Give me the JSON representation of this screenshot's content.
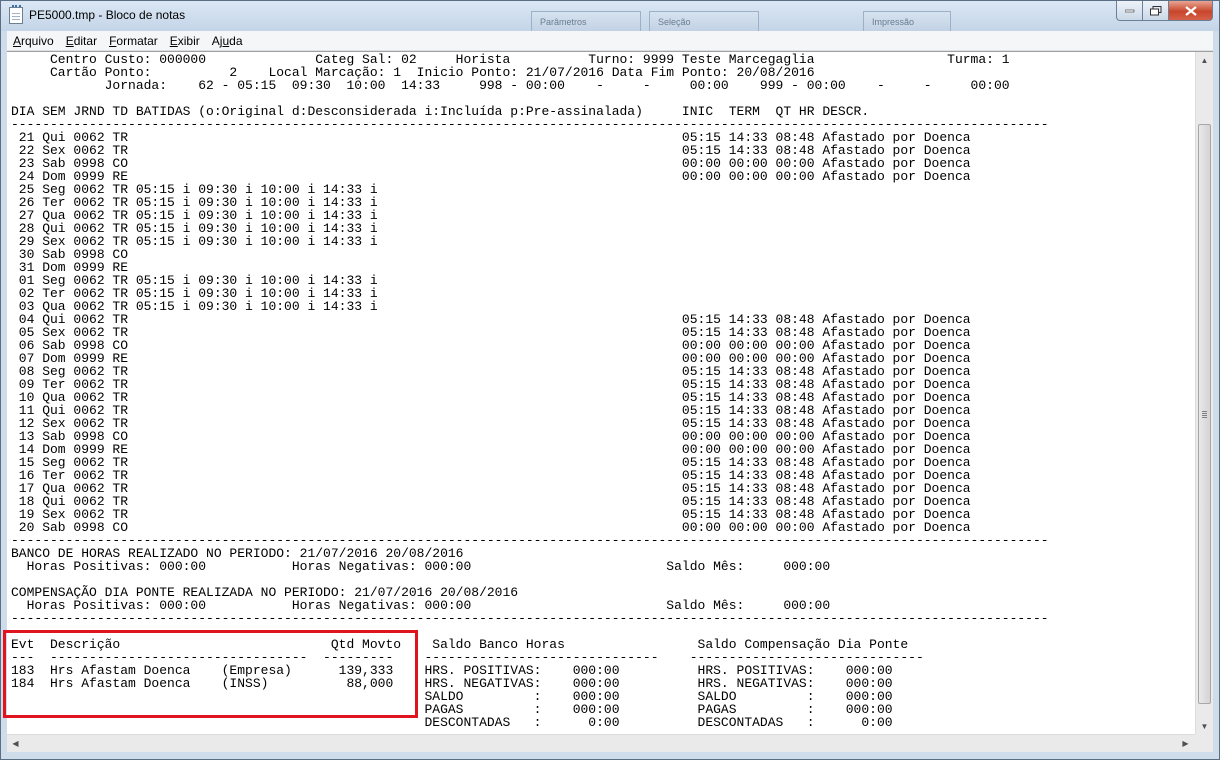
{
  "window": {
    "title": "PE5000.tmp - Bloco de notas",
    "background_tabs": [
      "Parâmetros",
      "Seleção",
      "Impressão"
    ]
  },
  "menu": [
    {
      "prefix": "",
      "underline": "A",
      "rest": "rquivo"
    },
    {
      "prefix": "",
      "underline": "E",
      "rest": "ditar"
    },
    {
      "prefix": "",
      "underline": "F",
      "rest": "ormatar"
    },
    {
      "prefix": "",
      "underline": "E",
      "rest": "xibir"
    },
    {
      "prefix": "Aj",
      "underline": "u",
      "rest": "da"
    }
  ],
  "document": {
    "lines": [
      "     Centro Custo: 000000              Categ Sal: 02     Horista          Turno: 9999 Teste Marcegaglia                 Turma: 1",
      "     Cartão Ponto:          2    Local Marcação: 1  Inicio Ponto: 21/07/2016 Data Fim Ponto: 20/08/2016",
      "            Jornada:    62 - 05:15  09:30  10:00  14:33     998 - 00:00    -     -     00:00    999 - 00:00    -     -     00:00",
      "",
      "DIA SEM JRND TD BATIDAS (o:Original d:Desconsiderada i:Incluída p:Pre-assinalada)     INIC  TERM  QT HR DESCR.",
      "-------------------------------------------------------------------------------------------------------------------------------------",
      " 21 Qui 0062 TR                                                                       05:15 14:33 08:48 Afastado por Doenca",
      " 22 Sex 0062 TR                                                                       05:15 14:33 08:48 Afastado por Doenca",
      " 23 Sab 0998 CO                                                                       00:00 00:00 00:00 Afastado por Doenca",
      " 24 Dom 0999 RE                                                                       00:00 00:00 00:00 Afastado por Doenca",
      " 25 Seg 0062 TR 05:15 i 09:30 i 10:00 i 14:33 i",
      " 26 Ter 0062 TR 05:15 i 09:30 i 10:00 i 14:33 i",
      " 27 Qua 0062 TR 05:15 i 09:30 i 10:00 i 14:33 i",
      " 28 Qui 0062 TR 05:15 i 09:30 i 10:00 i 14:33 i",
      " 29 Sex 0062 TR 05:15 i 09:30 i 10:00 i 14:33 i",
      " 30 Sab 0998 CO",
      " 31 Dom 0999 RE",
      " 01 Seg 0062 TR 05:15 i 09:30 i 10:00 i 14:33 i",
      " 02 Ter 0062 TR 05:15 i 09:30 i 10:00 i 14:33 i",
      " 03 Qua 0062 TR 05:15 i 09:30 i 10:00 i 14:33 i",
      " 04 Qui 0062 TR                                                                       05:15 14:33 08:48 Afastado por Doenca",
      " 05 Sex 0062 TR                                                                       05:15 14:33 08:48 Afastado por Doenca",
      " 06 Sab 0998 CO                                                                       00:00 00:00 00:00 Afastado por Doenca",
      " 07 Dom 0999 RE                                                                       00:00 00:00 00:00 Afastado por Doenca",
      " 08 Seg 0062 TR                                                                       05:15 14:33 08:48 Afastado por Doenca",
      " 09 Ter 0062 TR                                                                       05:15 14:33 08:48 Afastado por Doenca",
      " 10 Qua 0062 TR                                                                       05:15 14:33 08:48 Afastado por Doenca",
      " 11 Qui 0062 TR                                                                       05:15 14:33 08:48 Afastado por Doenca",
      " 12 Sex 0062 TR                                                                       05:15 14:33 08:48 Afastado por Doenca",
      " 13 Sab 0998 CO                                                                       00:00 00:00 00:00 Afastado por Doenca",
      " 14 Dom 0999 RE                                                                       00:00 00:00 00:00 Afastado por Doenca",
      " 15 Seg 0062 TR                                                                       05:15 14:33 08:48 Afastado por Doenca",
      " 16 Ter 0062 TR                                                                       05:15 14:33 08:48 Afastado por Doenca",
      " 17 Qua 0062 TR                                                                       05:15 14:33 08:48 Afastado por Doenca",
      " 18 Qui 0062 TR                                                                       05:15 14:33 08:48 Afastado por Doenca",
      " 19 Sex 0062 TR                                                                       05:15 14:33 08:48 Afastado por Doenca",
      " 20 Sab 0998 CO                                                                       00:00 00:00 00:00 Afastado por Doenca",
      "-------------------------------------------------------------------------------------------------------------------------------------",
      "BANCO DE HORAS REALIZADO NO PERIODO: 21/07/2016 20/08/2016",
      "  Horas Positivas: 000:00           Horas Negativas: 000:00                         Saldo Mês:     000:00",
      "",
      "COMPENSAÇÃO DIA PONTE REALIZADA NO PERIODO: 21/07/2016 20/08/2016",
      "  Horas Positivas: 000:00           Horas Negativas: 000:00                         Saldo Mês:     000:00",
      "-------------------------------------------------------------------------------------------------------------------------------------",
      "",
      "Evt  Descrição                           Qtd Movto    Saldo Banco Horas                 Saldo Compensação Dia Ponte",
      "---  ---------------------------------  ---------    ------------------------------    ------------------------------",
      "183  Hrs Afastam Doenca    (Empresa)      139,333    HRS. POSITIVAS:    000:00          HRS. POSITIVAS:    000:00",
      "184  Hrs Afastam Doenca    (INSS)          88,000    HRS. NEGATIVAS:    000:00          HRS. NEGATIVAS:    000:00",
      "                                                     SALDO         :    000:00          SALDO         :    000:00",
      "                                                     PAGAS         :    000:00          PAGAS         :    000:00",
      "                                                     DESCONTADAS   :      0:00          DESCONTADAS   :      0:00"
    ]
  },
  "annotation": {
    "highlight_color": "#e0141e"
  }
}
